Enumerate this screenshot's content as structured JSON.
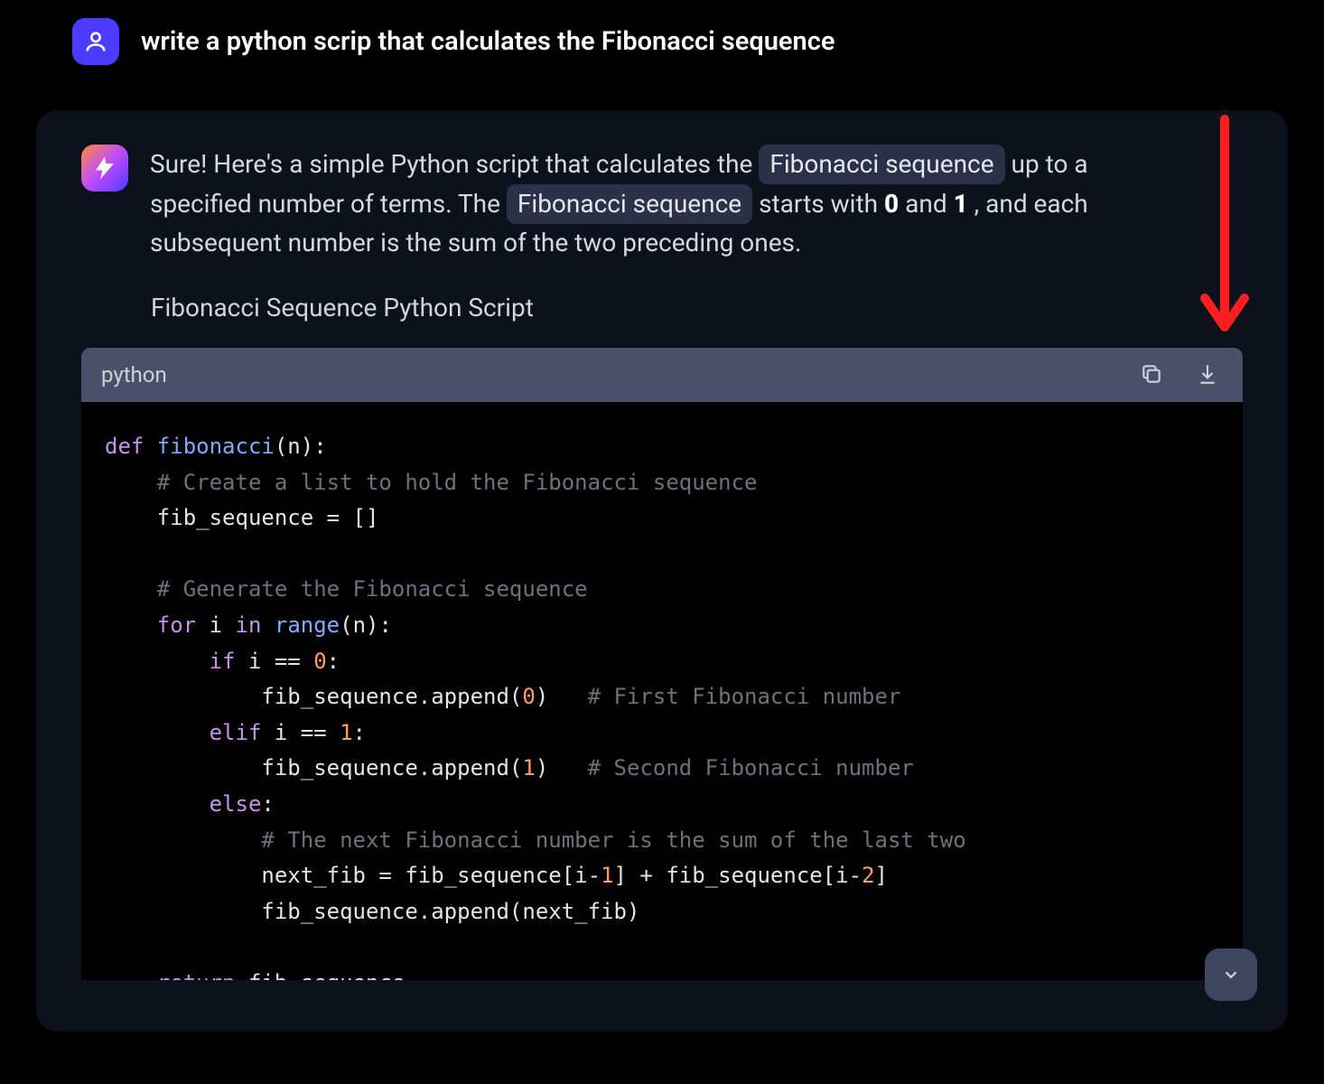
{
  "user": {
    "prompt": "write a python scrip that calculates the Fibonacci sequence"
  },
  "assistant": {
    "intro_prefix": "Sure! Here's a simple Python script that calculates the ",
    "pill1": "Fibonacci sequence",
    "intro_mid": " up to a specified number of terms. The ",
    "pill2": "Fibonacci sequence",
    "intro_after_pill2": " starts with ",
    "bold0": "0",
    "and_text": " and ",
    "bold1": "1",
    "intro_tail": ", and each subsequent number is the sum of the two preceding ones.",
    "script_title": "Fibonacci Sequence Python Script"
  },
  "code": {
    "language": "python",
    "l1_def": "def",
    "l1_fn": " fibonacci",
    "l1_rest": "(n):",
    "l2_cmnt": "    # Create a list to hold the Fibonacci sequence",
    "l3": "    fib_sequence = []",
    "l4": "",
    "l5_cmnt": "    # Generate the Fibonacci sequence",
    "l6_for": "    for",
    "l6_i": " i ",
    "l6_in": "in",
    "l6_range": " range",
    "l6_rest": "(n):",
    "l7_if": "        if",
    "l7_rest": " i == ",
    "l7_num": "0",
    "l7_colon": ":",
    "l8_a": "            fib_sequence.append(",
    "l8_num": "0",
    "l8_b": ")   ",
    "l8_cmnt": "# First Fibonacci number",
    "l9_elif": "        elif",
    "l9_rest": " i == ",
    "l9_num": "1",
    "l9_colon": ":",
    "l10_a": "            fib_sequence.append(",
    "l10_num": "1",
    "l10_b": ")   ",
    "l10_cmnt": "# Second Fibonacci number",
    "l11_else": "        else",
    "l11_colon": ":",
    "l12_cmnt": "            # The next Fibonacci number is the sum of the last two",
    "l13_a": "            next_fib = fib_sequence[i-",
    "l13_n1": "1",
    "l13_b": "] + fib_sequence[i-",
    "l13_n2": "2",
    "l13_c": "]",
    "l14": "            fib_sequence.append(next_fib)",
    "l15": "",
    "l16_ret": "    return",
    "l16_rest": " fib_sequence"
  }
}
